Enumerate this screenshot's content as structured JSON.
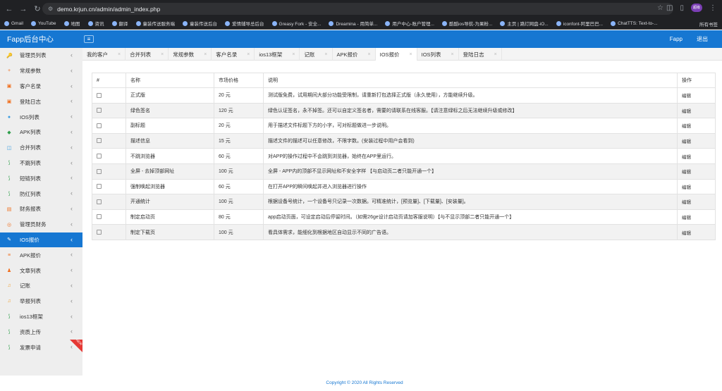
{
  "browser": {
    "url": "demo.krjun.cn/admin/admin_index.php",
    "bookmarks": [
      "Gmail",
      "YouTube",
      "地图",
      "资讯",
      "翻译",
      "童装传送服务端",
      "童装传送后台",
      "爱情辅导总后台",
      "Greasy Fork - 安全...",
      "Dreamina - 用简单...",
      "用户中心-账户管理...",
      "酷酷ios导航-为果粉...",
      "主页 | 路灯网盘-iO...",
      "iconfont-阿里巴巴...",
      "ChatTTS: Text-to-..."
    ],
    "all_bookmarks": "所有书签",
    "profile": "超级"
  },
  "header": {
    "logo": "Fapp后台中心",
    "user": "Fapp",
    "logout": "退出"
  },
  "sidebar": {
    "items": [
      {
        "label": "管理员列表",
        "icon_color": "#f0a030"
      },
      {
        "label": "常规参数",
        "icon_color": "#f07020"
      },
      {
        "label": "客户名录",
        "icon_color": "#f07020"
      },
      {
        "label": "登陆日志",
        "icon_color": "#f07020"
      },
      {
        "label": "IOS列表",
        "icon_color": "#3a9be0"
      },
      {
        "label": "APK列表",
        "icon_color": "#2e9e4a"
      },
      {
        "label": "合并列表",
        "icon_color": "#3a9be0"
      },
      {
        "label": "不跳列表",
        "icon_color": "#2e9e4a"
      },
      {
        "label": "短链列表",
        "icon_color": "#2e9e4a"
      },
      {
        "label": "防红列表",
        "icon_color": "#2e9e4a"
      },
      {
        "label": "财务报表",
        "icon_color": "#f07020"
      },
      {
        "label": "管理员财务",
        "icon_color": "#f07020"
      },
      {
        "label": "IOS报价",
        "icon_color": "#ffffff"
      },
      {
        "label": "APK报价",
        "icon_color": "#f07020"
      },
      {
        "label": "文章列表",
        "icon_color": "#f07020"
      },
      {
        "label": "记账",
        "icon_color": "#f0a030"
      },
      {
        "label": "举报列表",
        "icon_color": "#f0a030"
      },
      {
        "label": "ios13框架",
        "icon_color": "#2e9e4a"
      },
      {
        "label": "资质上传",
        "icon_color": "#2e9e4a"
      },
      {
        "label": "发票申请",
        "icon_color": "#2e9e4a"
      }
    ],
    "active_index": 12,
    "new_badge": "NEW"
  },
  "tabs": [
    "我的客户",
    "合并列表",
    "常规参数",
    "客户名录",
    "ios13框架",
    "记账",
    "APK报价",
    "IOS报价",
    "IOS列表",
    "登陆日志"
  ],
  "active_tab": 7,
  "table": {
    "headers": [
      "#",
      "名称",
      "市场价格",
      "说明",
      "操作"
    ],
    "rows": [
      {
        "name": "正式版",
        "price": "20 元",
        "desc": "测试版免费，试用期间大部分功能受限制，请重新打包选择正式版（永久使用），方能继续升级。",
        "op": "编辑"
      },
      {
        "name": "绿色签名",
        "price": "120 元",
        "desc": "绿色认证签名，永不掉签。还可以自定义签名者，需要的请联系在线客服。【请注意绿标之后无法继续升级或修改】",
        "op": "编辑"
      },
      {
        "name": "副标题",
        "price": "20 元",
        "desc": "用于描述文件标题下方的小字，可对标题做进一步说明。",
        "op": "编辑"
      },
      {
        "name": "描述信息",
        "price": "15 元",
        "desc": "描述文件的描述可以任意修改，不限字数。(安装过程中用户会看到)",
        "op": "编辑"
      },
      {
        "name": "不跳浏览器",
        "price": "60 元",
        "desc": "对APP的操作过程中不会跳到浏览器，始终在APP里运行。",
        "op": "编辑"
      },
      {
        "name": "全屏 - 去掉顶部网址",
        "price": "100 元",
        "desc": "全屏 - APP内的顶部不显示网址和不安全字样 【与启动页二者只能开通一个】",
        "op": "编辑"
      },
      {
        "name": "强制唤起浏览器",
        "price": "60 元",
        "desc": "在打开APP的瞬间唤起并进入浏览器进行操作",
        "op": "编辑"
      },
      {
        "name": "开通统计",
        "price": "100 元",
        "desc": "根据设备号统计，一个设备号只记录一次数据。可精准统计，[预览量]、[下载量]、[安装量]。",
        "op": "编辑"
      },
      {
        "name": "制定启动页",
        "price": "80 元",
        "desc": "app启动页面，可设定启动后停留时间。（如需26ge设计启动页请加客服说明）【与不显示顶部二者只能开通一个】",
        "op": "编辑"
      },
      {
        "name": "制定下载页",
        "price": "100 元",
        "desc": "看具体需求，能细化到根据地区自动显示不同的广告语。",
        "op": "编辑"
      }
    ]
  },
  "footer": "Copyright © 2020 All Rights Reserved"
}
